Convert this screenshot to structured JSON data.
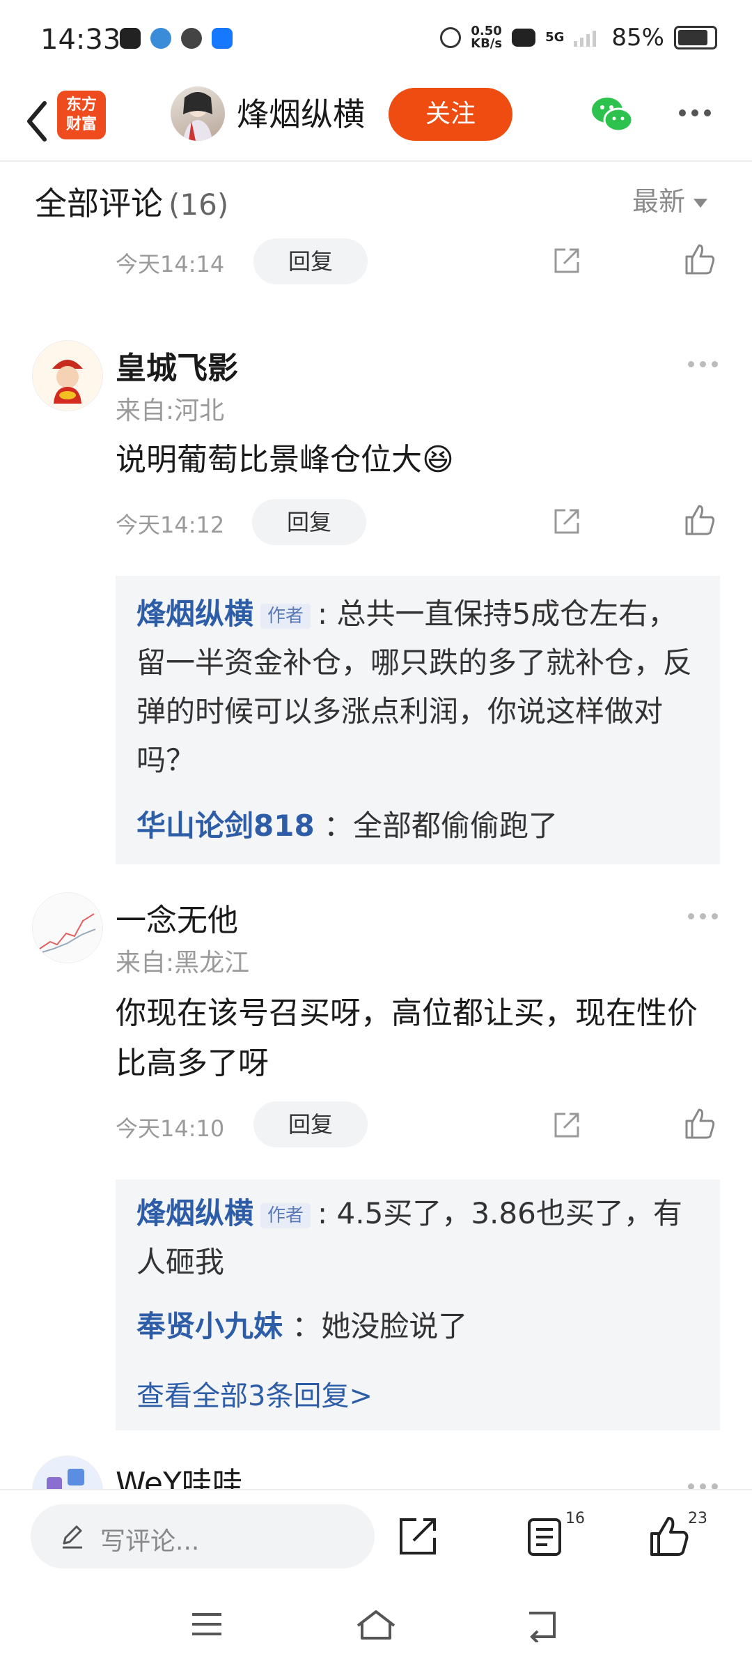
{
  "status_bar": {
    "time": "14:33",
    "net_speed_value": "0.50",
    "net_speed_unit": "KB/s",
    "network": "5G",
    "battery": "85%"
  },
  "header": {
    "back_icon": "chevron-left-icon",
    "logo_line1": "东方",
    "logo_line2": "财富",
    "author_name": "烽烟纵横",
    "follow_label": "关注",
    "wechat_icon": "wechat-icon",
    "more_icon": "more-dots-icon"
  },
  "comments_header": {
    "title": "全部评论",
    "count": "(16)",
    "sort_label": "最新"
  },
  "reply_label": "回复",
  "comments": [
    {
      "time": "今天14:14"
    },
    {
      "user": "皇城飞影",
      "location": "来自:河北",
      "text": "说明葡萄比景峰仓位大😆",
      "time": "今天14:12",
      "replies": [
        {
          "user": "烽烟纵横",
          "tag": "作者",
          "text": ": 总共一直保持5成仓左右，留一半资金补仓，哪只跌的多了就补仓，反弹的时候可以多涨点利润，你说这样做对吗？"
        },
        {
          "user": "华山论剑818",
          "text": "：全部都偷偷跑了"
        }
      ]
    },
    {
      "user": "一念无他",
      "location": "来自:黑龙江",
      "text": "你现在该号召买呀，高位都让买，现在性价比高多了呀",
      "time": "今天14:10",
      "replies": [
        {
          "user": "烽烟纵横",
          "tag": "作者",
          "text": ": 4.5买了，3.86也买了，有人砸我"
        },
        {
          "user": "奉贤小九妹",
          "text": "：她没脸说了"
        }
      ],
      "view_all": "查看全部3条回复>"
    },
    {
      "user": "WeY哇哇"
    }
  ],
  "bottom_bar": {
    "write_placeholder": "写评论...",
    "comment_count": "16",
    "like_count": "23"
  },
  "colors": {
    "accent": "#ee4c11",
    "link_blue": "#2e5da8"
  }
}
